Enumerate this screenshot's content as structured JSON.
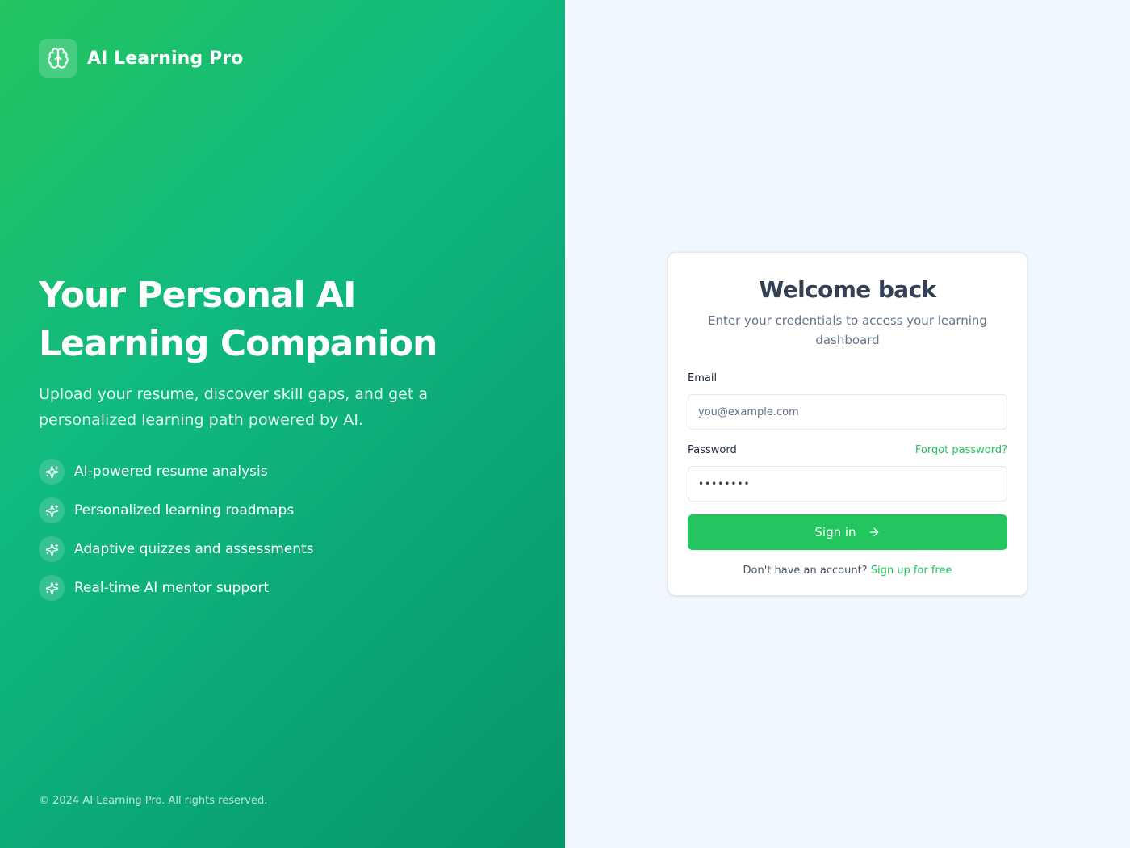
{
  "brand": {
    "name": "AI Learning Pro",
    "logo_icon": "brain-icon"
  },
  "hero": {
    "title_line1": "Your Personal AI",
    "title_line2": "Learning Companion",
    "subtitle": "Upload your resume, discover skill gaps, and get a personalized learning path powered by AI.",
    "feature_icon": "sparkles-icon",
    "features": [
      {
        "label": "AI-powered resume analysis"
      },
      {
        "label": "Personalized learning roadmaps"
      },
      {
        "label": "Adaptive quizzes and assessments"
      },
      {
        "label": "Real-time AI mentor support"
      }
    ],
    "copyright": "© 2024 AI Learning Pro. All rights reserved."
  },
  "login": {
    "title": "Welcome back",
    "subtitle": "Enter your credentials to access your learning dashboard",
    "email": {
      "label": "Email",
      "placeholder": "you@example.com",
      "value": ""
    },
    "password": {
      "label": "Password",
      "value": "password",
      "forgot_label": "Forgot password?"
    },
    "submit_label": "Sign in",
    "submit_icon": "arrow-right-icon",
    "signup_prompt": "Don't have an account?",
    "signup_link": "Sign up for free"
  },
  "colors": {
    "brand_green": "#22c55e",
    "hero_gradient_start": "#22c55e",
    "hero_gradient_end": "#059669",
    "page_background": "#f0f7fd",
    "heading_text": "#334155"
  }
}
